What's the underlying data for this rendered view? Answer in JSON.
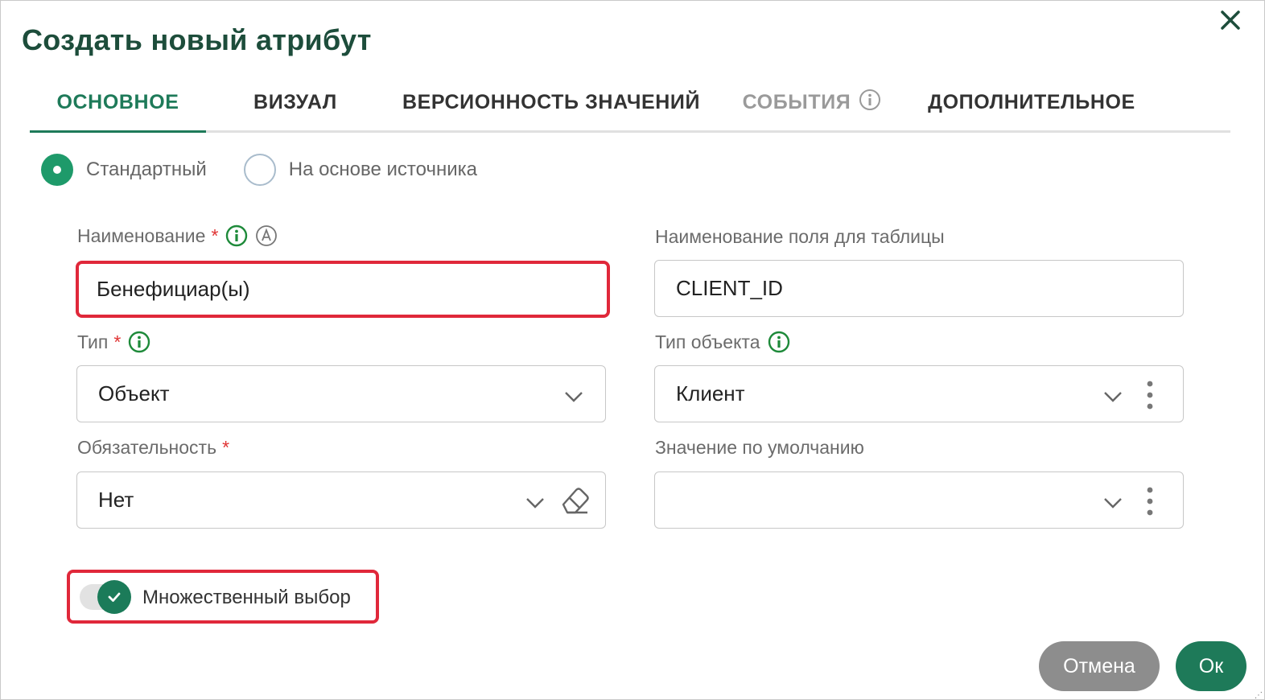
{
  "dialog": {
    "title": "Создать новый атрибут"
  },
  "tabs": [
    {
      "label": "ОСНОВНОЕ",
      "state": "active"
    },
    {
      "label": "ВИЗУАЛ",
      "state": "normal"
    },
    {
      "label": "ВЕРСИОННОСТЬ ЗНАЧЕНИЙ",
      "state": "normal"
    },
    {
      "label": "СОБЫТИЯ",
      "state": "disabled"
    },
    {
      "label": "ДОПОЛНИТЕЛЬНОЕ",
      "state": "normal"
    }
  ],
  "radio": {
    "options": [
      {
        "label": "Стандартный",
        "checked": true
      },
      {
        "label": "На основе источника",
        "checked": false
      }
    ]
  },
  "form": {
    "name": {
      "label": "Наименование",
      "required": "*",
      "value": "Бенефициар(ы)"
    },
    "table_field": {
      "label": "Наименование поля для таблицы",
      "value": "CLIENT_ID"
    },
    "type": {
      "label": "Тип",
      "required": "*",
      "value": "Объект"
    },
    "object_type": {
      "label": "Тип объекта",
      "value": "Клиент"
    },
    "mandatory": {
      "label": "Обязательность",
      "required": "*",
      "value": "Нет"
    },
    "default_value": {
      "label": "Значение по умолчанию",
      "value": ""
    }
  },
  "multiple_choice": {
    "label": "Множественный выбор",
    "enabled": true
  },
  "buttons": {
    "cancel": "Отмена",
    "ok": "Ок"
  },
  "colors": {
    "accent": "#1e7a59",
    "title": "#1d4d3b",
    "required": "#e03434",
    "highlight": "#e0283a",
    "cancel_bg": "#8d8d8d"
  },
  "icons": [
    "close-icon",
    "info-icon",
    "auto-icon",
    "chevron-down-icon",
    "kebab-icon",
    "eraser-icon",
    "check-icon"
  ]
}
